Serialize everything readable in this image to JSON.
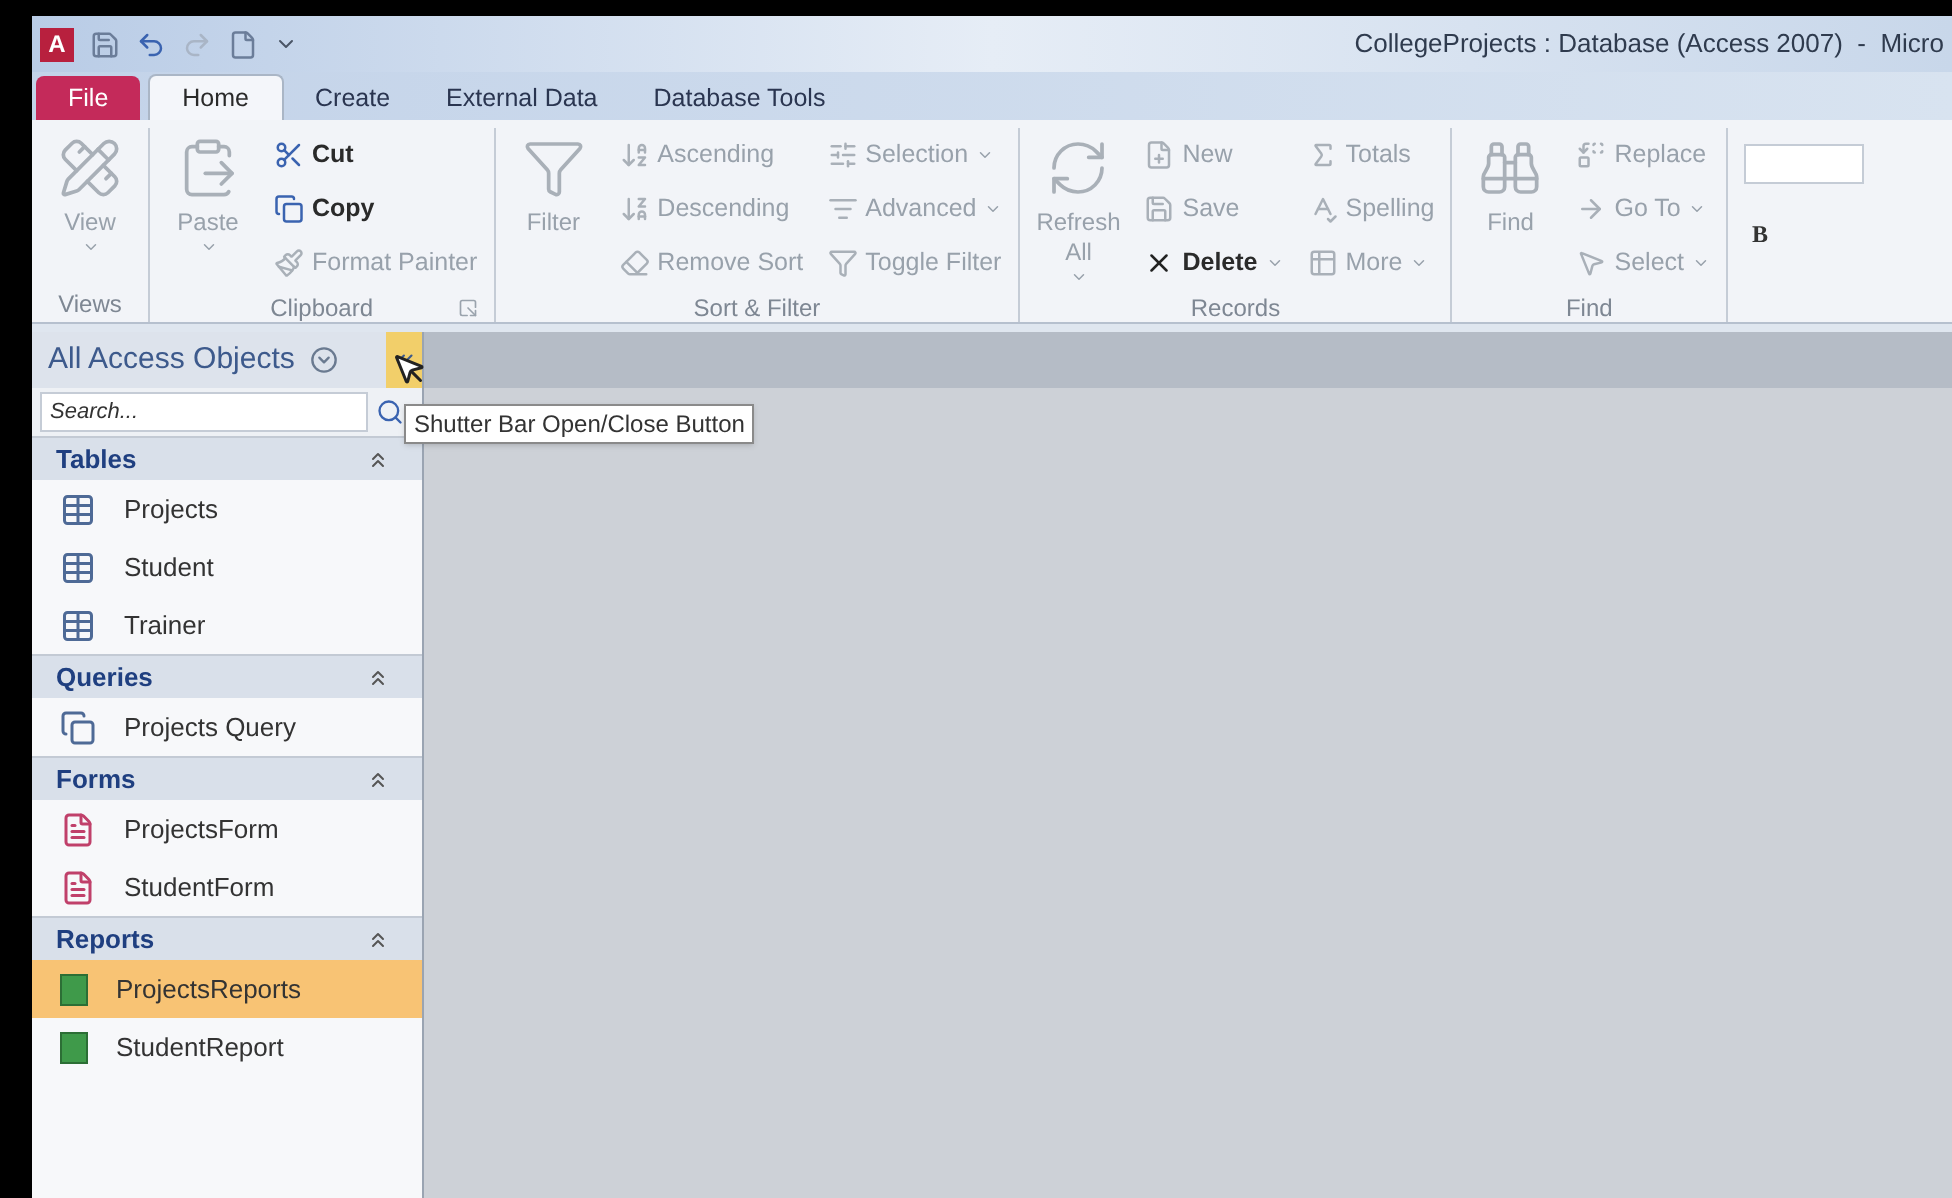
{
  "window": {
    "app_letter": "A",
    "title": "CollegeProjects : Database (Access 2007)  -  Micro"
  },
  "tabs": [
    {
      "label": "File",
      "kind": "file",
      "selected": false
    },
    {
      "label": "Home",
      "kind": "tab",
      "selected": true
    },
    {
      "label": "Create",
      "kind": "tab",
      "selected": false
    },
    {
      "label": "External Data",
      "kind": "tab",
      "selected": false
    },
    {
      "label": "Database Tools",
      "kind": "tab",
      "selected": false
    }
  ],
  "ribbon": {
    "groups": [
      {
        "label": "Views",
        "launcher": false,
        "items": [
          {
            "label": "View",
            "kind": "large",
            "disabled": true,
            "dropdown": true
          }
        ]
      },
      {
        "label": "Clipboard",
        "launcher": true,
        "items": [
          {
            "label": "Paste",
            "kind": "large",
            "disabled": true,
            "dropdown": true
          },
          {
            "label": "Cut",
            "kind": "small",
            "disabled": false,
            "dropdown": false
          },
          {
            "label": "Copy",
            "kind": "small",
            "disabled": false,
            "dropdown": false
          },
          {
            "label": "Format Painter",
            "kind": "small",
            "disabled": true,
            "dropdown": false
          }
        ]
      },
      {
        "label": "Sort & Filter",
        "launcher": false,
        "items": [
          {
            "label": "Filter",
            "kind": "large",
            "disabled": true,
            "dropdown": false
          },
          {
            "label": "Ascending",
            "kind": "small",
            "disabled": true,
            "dropdown": false
          },
          {
            "label": "Descending",
            "kind": "small",
            "disabled": true,
            "dropdown": false
          },
          {
            "label": "Remove Sort",
            "kind": "small",
            "disabled": true,
            "dropdown": false
          },
          {
            "label": "Selection",
            "kind": "small",
            "disabled": true,
            "dropdown": true
          },
          {
            "label": "Advanced",
            "kind": "small",
            "disabled": true,
            "dropdown": true
          },
          {
            "label": "Toggle Filter",
            "kind": "small",
            "disabled": true,
            "dropdown": false
          }
        ]
      },
      {
        "label": "Records",
        "launcher": false,
        "items": [
          {
            "label": "Refresh All",
            "kind": "large",
            "disabled": true,
            "dropdown": true
          },
          {
            "label": "New",
            "kind": "small",
            "disabled": true,
            "dropdown": false
          },
          {
            "label": "Save",
            "kind": "small",
            "disabled": true,
            "dropdown": false
          },
          {
            "label": "Delete",
            "kind": "small",
            "disabled": false,
            "dropdown": true
          },
          {
            "label": "Totals",
            "kind": "small",
            "disabled": true,
            "dropdown": false
          },
          {
            "label": "Spelling",
            "kind": "small",
            "disabled": true,
            "dropdown": false
          },
          {
            "label": "More",
            "kind": "small",
            "disabled": true,
            "dropdown": true
          }
        ]
      },
      {
        "label": "Find",
        "launcher": false,
        "items": [
          {
            "label": "Find",
            "kind": "large",
            "disabled": true,
            "dropdown": false
          },
          {
            "label": "Replace",
            "kind": "small",
            "disabled": true,
            "dropdown": false
          },
          {
            "label": "Go To",
            "kind": "small",
            "disabled": true,
            "dropdown": true
          },
          {
            "label": "Select",
            "kind": "small",
            "disabled": true,
            "dropdown": true
          }
        ]
      }
    ],
    "bold_button": "B"
  },
  "navigation": {
    "title": "All Access Objects",
    "search": {
      "placeholder": "Search..."
    },
    "tooltip": "Shutter Bar Open/Close Button",
    "groups": [
      {
        "label": "Tables",
        "expanded": true,
        "items": [
          {
            "label": "Projects",
            "kind": "table",
            "selected": false
          },
          {
            "label": "Student",
            "kind": "table",
            "selected": false
          },
          {
            "label": "Trainer",
            "kind": "table",
            "selected": false
          }
        ]
      },
      {
        "label": "Queries",
        "expanded": true,
        "items": [
          {
            "label": "Projects Query",
            "kind": "query",
            "selected": false
          }
        ]
      },
      {
        "label": "Forms",
        "expanded": true,
        "items": [
          {
            "label": "ProjectsForm",
            "kind": "form",
            "selected": false
          },
          {
            "label": "StudentForm",
            "kind": "form",
            "selected": false
          }
        ]
      },
      {
        "label": "Reports",
        "expanded": true,
        "items": [
          {
            "label": "ProjectsReports",
            "kind": "report",
            "selected": true
          },
          {
            "label": "StudentReport",
            "kind": "report",
            "selected": false
          }
        ]
      }
    ]
  }
}
